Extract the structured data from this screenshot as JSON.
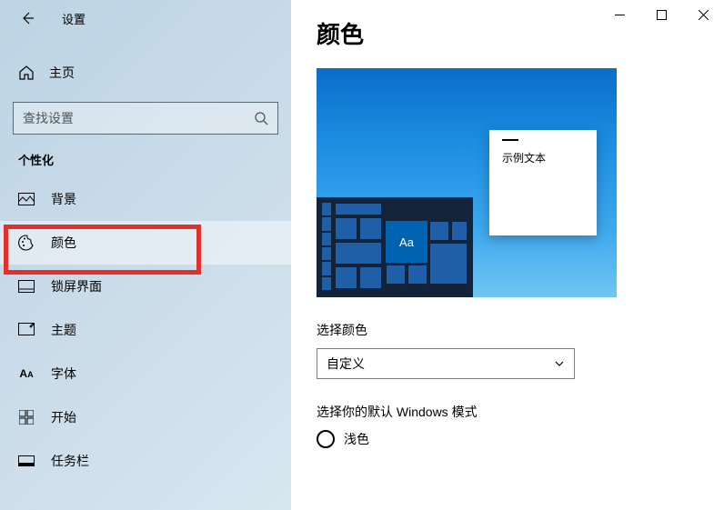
{
  "titlebar": {
    "title": "设置"
  },
  "home": {
    "label": "主页"
  },
  "search": {
    "placeholder": "查找设置"
  },
  "section": {
    "label": "个性化"
  },
  "nav": {
    "items": [
      {
        "id": "background",
        "label": "背景"
      },
      {
        "id": "color",
        "label": "颜色"
      },
      {
        "id": "lockscreen",
        "label": "锁屏界面"
      },
      {
        "id": "theme",
        "label": "主题"
      },
      {
        "id": "font",
        "label": "字体"
      },
      {
        "id": "start",
        "label": "开始"
      },
      {
        "id": "taskbar",
        "label": "任务栏"
      }
    ],
    "active": "color"
  },
  "page": {
    "title": "颜色"
  },
  "preview": {
    "sample_text": "示例文本",
    "aa": "Aa"
  },
  "settings": {
    "choose_color_label": "选择颜色",
    "choose_color_value": "自定义",
    "default_mode_label": "选择你的默认 Windows 模式",
    "light_option": "浅色"
  }
}
